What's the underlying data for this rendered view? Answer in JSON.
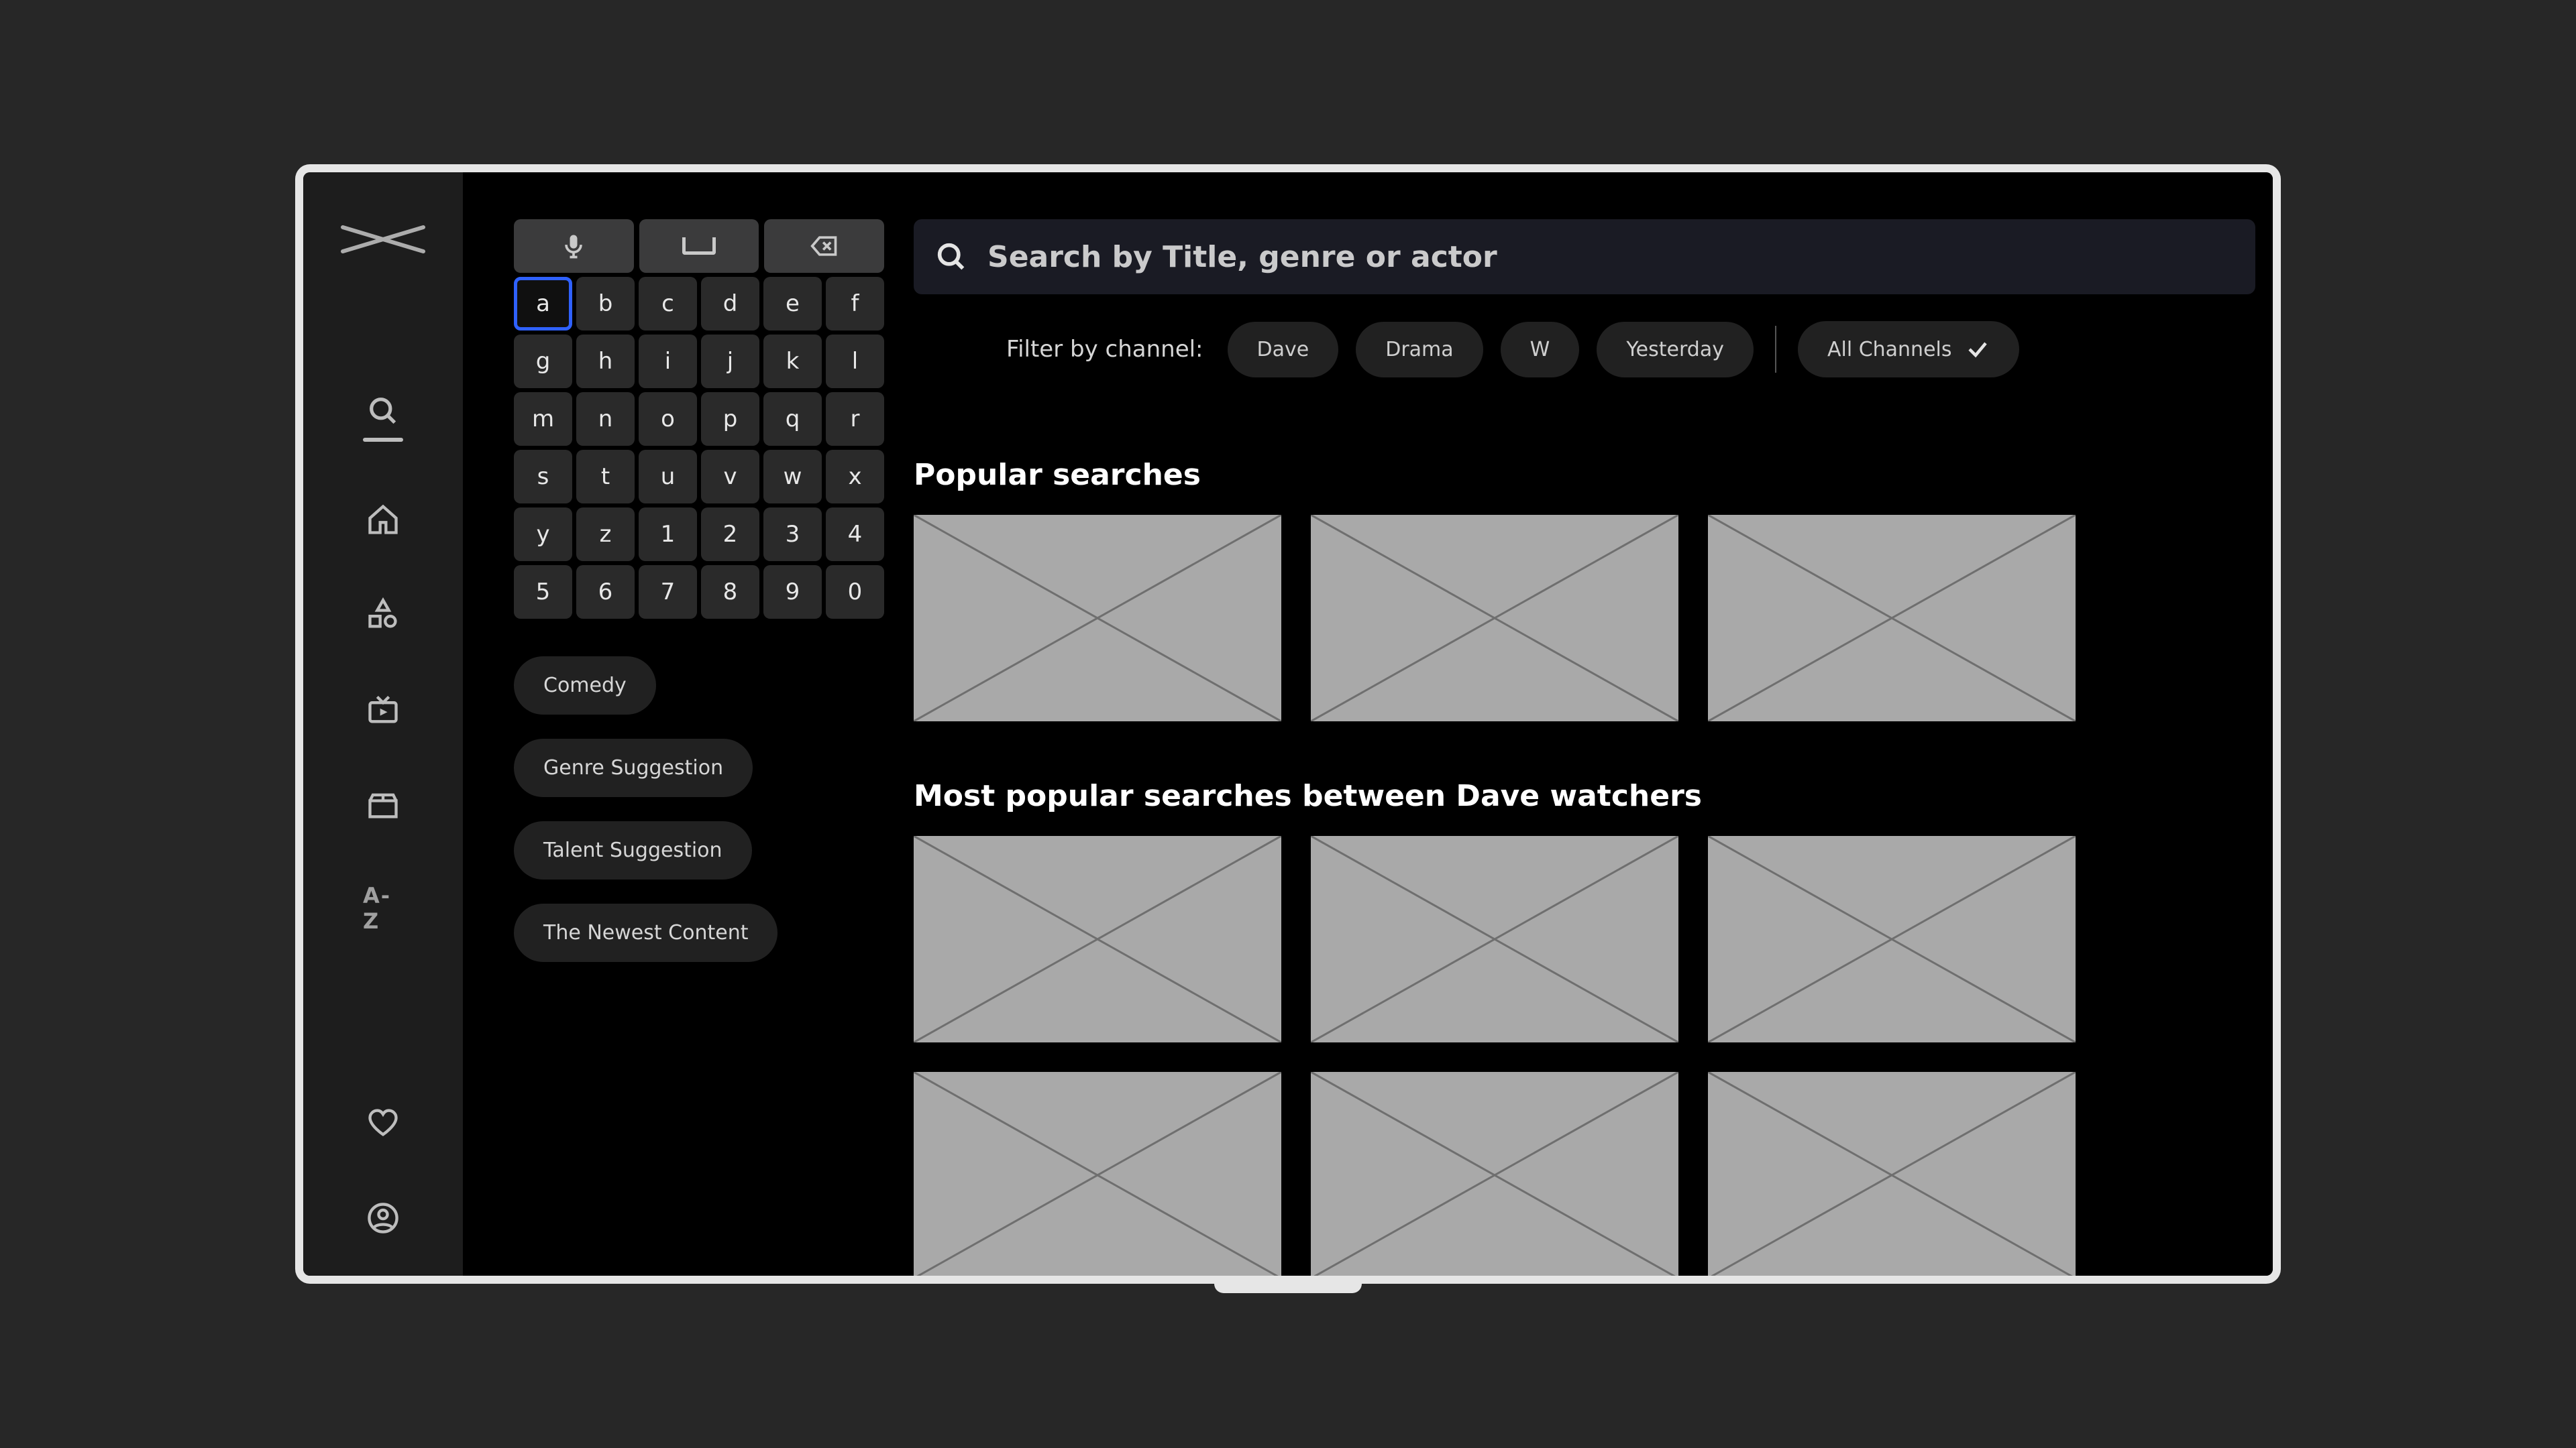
{
  "sidebar": {
    "items": [
      {
        "id": "search",
        "active": true
      },
      {
        "id": "home"
      },
      {
        "id": "categories"
      },
      {
        "id": "tv"
      },
      {
        "id": "box"
      },
      {
        "id": "az",
        "label": "A-Z"
      }
    ],
    "bottom": [
      {
        "id": "favourites"
      },
      {
        "id": "account"
      }
    ]
  },
  "search": {
    "placeholder": "Search by Title, genre or actor"
  },
  "keypad": {
    "focused": "a",
    "keys": [
      "a",
      "b",
      "c",
      "d",
      "e",
      "f",
      "g",
      "h",
      "i",
      "j",
      "k",
      "l",
      "m",
      "n",
      "o",
      "p",
      "q",
      "r",
      "s",
      "t",
      "u",
      "v",
      "w",
      "x",
      "y",
      "z",
      "1",
      "2",
      "3",
      "4",
      "5",
      "6",
      "7",
      "8",
      "9",
      "0"
    ]
  },
  "suggestions": [
    "Comedy",
    "Genre Suggestion",
    "Talent Suggestion",
    "The Newest Content"
  ],
  "filter": {
    "label": "Filter by channel:",
    "chips": [
      "Dave",
      "Drama",
      "W",
      "Yesterday"
    ],
    "all": "All Channels"
  },
  "sections": [
    {
      "title": "Popular searches",
      "cards": 3
    },
    {
      "title": "Most popular searches between Dave watchers",
      "cards": 6
    }
  ]
}
